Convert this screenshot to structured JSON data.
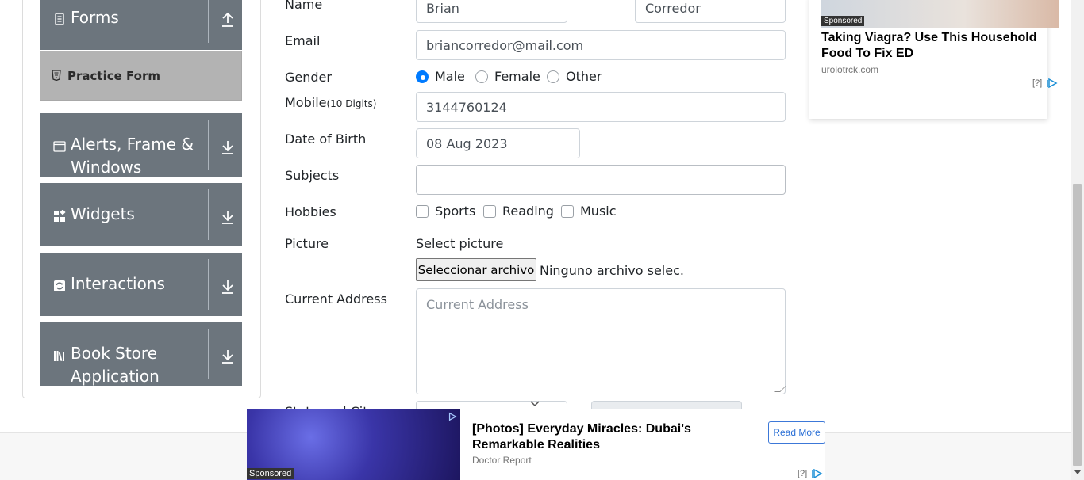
{
  "sidebar": {
    "forms": {
      "label": "Forms",
      "icon": "form-icon",
      "arrow": "collapse-up-icon"
    },
    "practice_form": {
      "label": "Practice Form",
      "icon": "html5-icon"
    },
    "alerts": {
      "label": "Alerts, Frame & Windows",
      "icon": "window-icon",
      "arrow": "expand-down-icon"
    },
    "widgets": {
      "label": "Widgets",
      "icon": "widgets-icon",
      "arrow": "expand-down-icon"
    },
    "interactions": {
      "label": "Interactions",
      "icon": "interactions-icon",
      "arrow": "expand-down-icon"
    },
    "book_store": {
      "label": "Book Store Application",
      "icon": "books-icon",
      "arrow": "expand-down-icon"
    }
  },
  "form": {
    "name_label": "Name",
    "first_name": "Brian",
    "last_name": "Corredor",
    "email_label": "Email",
    "email": "briancorredor@mail.com",
    "gender_label": "Gender",
    "gender_options": [
      "Male",
      "Female",
      "Other"
    ],
    "gender_selected": "Male",
    "mobile_label": "Mobile",
    "mobile_hint": "(10 Digits)",
    "mobile": "3144760124",
    "dob_label": "Date of Birth",
    "dob": "08 Aug 2023",
    "subjects_label": "Subjects",
    "subjects": "",
    "hobbies_label": "Hobbies",
    "hobbies_options": [
      "Sports",
      "Reading",
      "Music"
    ],
    "picture_label": "Picture",
    "picture_prompt": "Select picture",
    "file_button": "Seleccionar archivo",
    "file_name": "Ninguno archivo selec.",
    "address_label": "Current Address",
    "address_placeholder": "Current Address",
    "state_city_label": "State and City"
  },
  "ads": {
    "right": {
      "badge": "Sponsored",
      "title": "Taking Viagra? Use This Household Food To Fix ED",
      "source": "urolotrck.com",
      "help": "[?]"
    },
    "bottom": {
      "badge": "Sponsored",
      "title": "[Photos] Everyday Miracles: Dubai's Remarkable Realities",
      "source": "Doctor Report",
      "cta": "Read More",
      "help": "[?]"
    }
  },
  "colors": {
    "sidebar_bg": "#6c757d",
    "active_item_bg": "#b3b3b3",
    "accent": "#007bff"
  }
}
